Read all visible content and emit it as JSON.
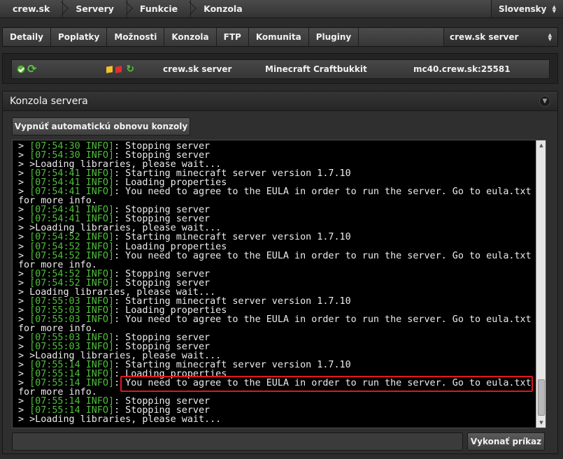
{
  "breadcrumb": [
    "crew.sk",
    "Servery",
    "Funkcie",
    "Konzola"
  ],
  "language": {
    "selected": "Slovensky"
  },
  "tabs": [
    "Detaily",
    "Poplatky",
    "Možnosti",
    "Konzola",
    "FTP",
    "Komunita",
    "Pluginy"
  ],
  "server_select": {
    "selected": "crew.sk server"
  },
  "server_info": {
    "name": "crew.sk server",
    "type": "Minecraft Craftbukkit",
    "address": "mc40.crew.sk:25581"
  },
  "console_panel": {
    "title": "Konzola servera",
    "toggle_button": "Vypnúť automatickú obnovu konzoly",
    "submit_button": "Vykonať príkaz",
    "command_value": ""
  },
  "colors": {
    "log_tag": "#4fbf3a",
    "highlight_box": "#e11818",
    "console_bg": "#000000"
  },
  "console_lines": [
    {
      "prefix": "> ",
      "tag": "[07:54:30 INFO]",
      "text": ": Stopping server"
    },
    {
      "prefix": "> ",
      "tag": "[07:54:30 INFO]",
      "text": ": Stopping server"
    },
    {
      "prefix": "> >Loading libraries, please wait...",
      "tag": "",
      "text": ""
    },
    {
      "prefix": "> ",
      "tag": "[07:54:41 INFO]",
      "text": ": Starting minecraft server version 1.7.10"
    },
    {
      "prefix": "> ",
      "tag": "[07:54:41 INFO]",
      "text": ": Loading properties"
    },
    {
      "prefix": "> ",
      "tag": "[07:54:41 INFO]",
      "text": ": You need to agree to the EULA in order to run the server. Go to eula.txt"
    },
    {
      "prefix": "for more info.",
      "tag": "",
      "text": ""
    },
    {
      "prefix": "> ",
      "tag": "[07:54:41 INFO]",
      "text": ": Stopping server"
    },
    {
      "prefix": "> ",
      "tag": "[07:54:41 INFO]",
      "text": ": Stopping server"
    },
    {
      "prefix": "> >Loading libraries, please wait...",
      "tag": "",
      "text": ""
    },
    {
      "prefix": "> ",
      "tag": "[07:54:52 INFO]",
      "text": ": Starting minecraft server version 1.7.10"
    },
    {
      "prefix": "> ",
      "tag": "[07:54:52 INFO]",
      "text": ": Loading properties"
    },
    {
      "prefix": "> ",
      "tag": "[07:54:52 INFO]",
      "text": ": You need to agree to the EULA in order to run the server. Go to eula.txt"
    },
    {
      "prefix": "for more info.",
      "tag": "",
      "text": ""
    },
    {
      "prefix": "> ",
      "tag": "[07:54:52 INFO]",
      "text": ": Stopping server"
    },
    {
      "prefix": "> ",
      "tag": "[07:54:52 INFO]",
      "text": ": Stopping server"
    },
    {
      "prefix": "> Loading libraries, please wait...",
      "tag": "",
      "text": ""
    },
    {
      "prefix": "> ",
      "tag": "[07:55:03 INFO]",
      "text": ": Starting minecraft server version 1.7.10"
    },
    {
      "prefix": "> ",
      "tag": "[07:55:03 INFO]",
      "text": ": Loading properties"
    },
    {
      "prefix": "> ",
      "tag": "[07:55:03 INFO]",
      "text": ": You need to agree to the EULA in order to run the server. Go to eula.txt"
    },
    {
      "prefix": "for more info.",
      "tag": "",
      "text": ""
    },
    {
      "prefix": "> ",
      "tag": "[07:55:03 INFO]",
      "text": ": Stopping server"
    },
    {
      "prefix": "> ",
      "tag": "[07:55:03 INFO]",
      "text": ": Stopping server"
    },
    {
      "prefix": "> >Loading libraries, please wait...",
      "tag": "",
      "text": ""
    },
    {
      "prefix": "> ",
      "tag": "[07:55:14 INFO]",
      "text": ": Starting minecraft server version 1.7.10"
    },
    {
      "prefix": "> ",
      "tag": "[07:55:14 INFO]",
      "text": ": Loading properties"
    },
    {
      "prefix": "> ",
      "tag": "[07:55:14 INFO]",
      "text": ": You need to agree to the EULA in order to run the server. Go to eula.txt"
    },
    {
      "prefix": "for more info.",
      "tag": "",
      "text": ""
    },
    {
      "prefix": "> ",
      "tag": "[07:55:14 INFO]",
      "text": ": Stopping server"
    },
    {
      "prefix": "> ",
      "tag": "[07:55:14 INFO]",
      "text": ": Stopping server"
    },
    {
      "prefix": "> >Loading libraries, please wait...",
      "tag": "",
      "text": ""
    }
  ]
}
